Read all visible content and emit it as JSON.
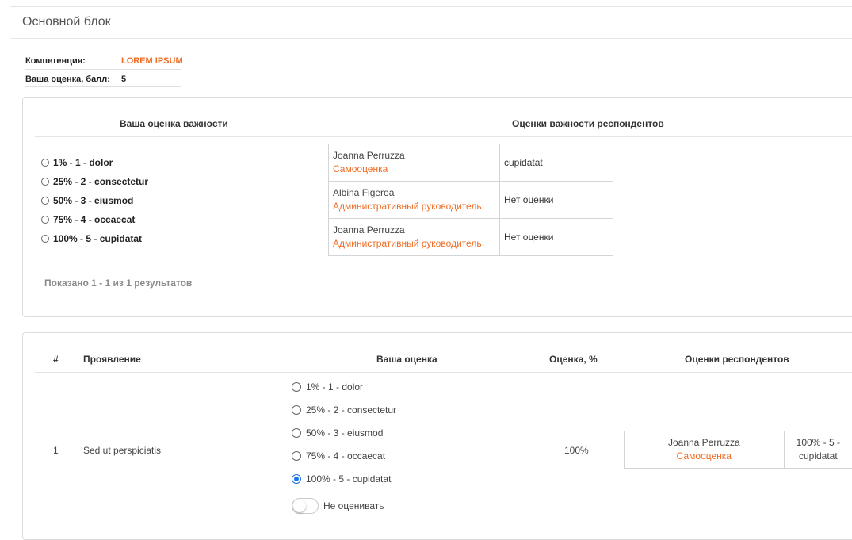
{
  "block": {
    "title": "Основной блок"
  },
  "info": {
    "competence_label": "Компетенция:",
    "competence_value": "LOREM IPSUM",
    "score_label": "Ваша оценка, балл:",
    "score_value": "5"
  },
  "importance": {
    "your_header": "Ваша оценка важности",
    "respondents_header": "Оценки важности респондентов",
    "options": [
      "1% - 1 - dolor",
      "25% - 2 - consectetur",
      "50% - 3 - eiusmod",
      "75% - 4 - occaecat",
      "100% - 5 - cupidatat"
    ],
    "respondents": [
      {
        "name": "Joanna Perruzza",
        "role": "Самооценка",
        "score": "cupidatat"
      },
      {
        "name": "Albina Figeroa",
        "role": "Административный руководитель",
        "score": "Нет оценки"
      },
      {
        "name": "Joanna Perruzza",
        "role": "Административный руководитель",
        "score": "Нет оценки"
      }
    ],
    "shown": "Показано 1 - 1 из 1 результатов"
  },
  "manifest": {
    "headers": {
      "num": "#",
      "manifestation": "Проявление",
      "your": "Ваша оценка",
      "percent": "Оценка, %",
      "respondents": "Оценки респондентов"
    },
    "row": {
      "num": "1",
      "manifestation": "Sed ut perspiciatis",
      "options": [
        "1% - 1 - dolor",
        "25% - 2 - consectetur",
        "50% - 3 - eiusmod",
        "75% - 4 - occaecat",
        "100% - 5 - cupidatat"
      ],
      "selected_index": 4,
      "no_rate_label": "Не оценивать",
      "no_rate_on": false,
      "percent": "100%",
      "respondent": {
        "name": "Joanna Perruzza",
        "role": "Самооценка",
        "score_line1": "100% - 5 -",
        "score_line2": "cupidatat"
      }
    }
  },
  "colors": {
    "accent": "#f06c24",
    "radio_checked": "#1a73e8"
  }
}
